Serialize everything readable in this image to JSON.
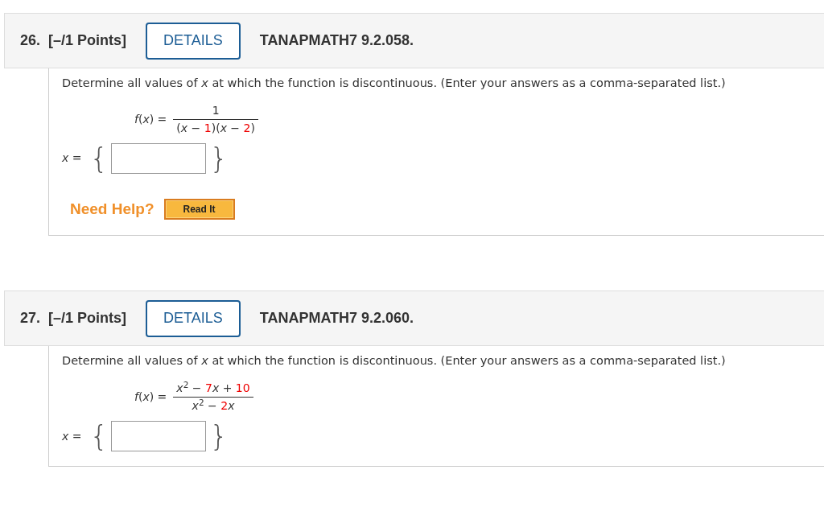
{
  "questions": [
    {
      "number": "26.",
      "points": "[–/1 Points]",
      "details_button": "DETAILS",
      "code": "TANAPMATH7 9.2.058.",
      "prompt": "Determine all values of *x* at which the function is discontinuous. (Enter your answers as a comma-separated list.)",
      "function_label": "*f*(*x*) =",
      "numerator": [
        {
          "kind": "text",
          "text": "1"
        }
      ],
      "denominator": [
        {
          "kind": "text",
          "text": "(*x* − "
        },
        {
          "kind": "number",
          "text": "1"
        },
        {
          "kind": "text",
          "text": ")(*x* − "
        },
        {
          "kind": "number",
          "text": "2"
        },
        {
          "kind": "text",
          "text": ")"
        }
      ],
      "answer": {
        "label": "*x* =",
        "open_brace": "{",
        "close_brace": "}"
      },
      "help": {
        "label": "Need Help?",
        "button": "Read It"
      }
    },
    {
      "number": "27.",
      "points": "[–/1 Points]",
      "details_button": "DETAILS",
      "code": "TANAPMATH7 9.2.060.",
      "prompt": "Determine all values of *x* at which the function is discontinuous. (Enter your answers as a comma-separated list.)",
      "function_label": "*f*(*x*) =",
      "numerator": [
        {
          "kind": "text",
          "text": "*x*$^{2}$ − "
        },
        {
          "kind": "number",
          "text": "7"
        },
        {
          "kind": "text",
          "text": "*x* + "
        },
        {
          "kind": "number",
          "text": "10"
        }
      ],
      "denominator": [
        {
          "kind": "text",
          "text": "*x*$^{2}$ − "
        },
        {
          "kind": "number",
          "text": "2"
        },
        {
          "kind": "text",
          "text": "*x*"
        }
      ],
      "answer": {
        "label": "*x* =",
        "open_brace": "{",
        "close_brace": "}"
      }
    }
  ]
}
